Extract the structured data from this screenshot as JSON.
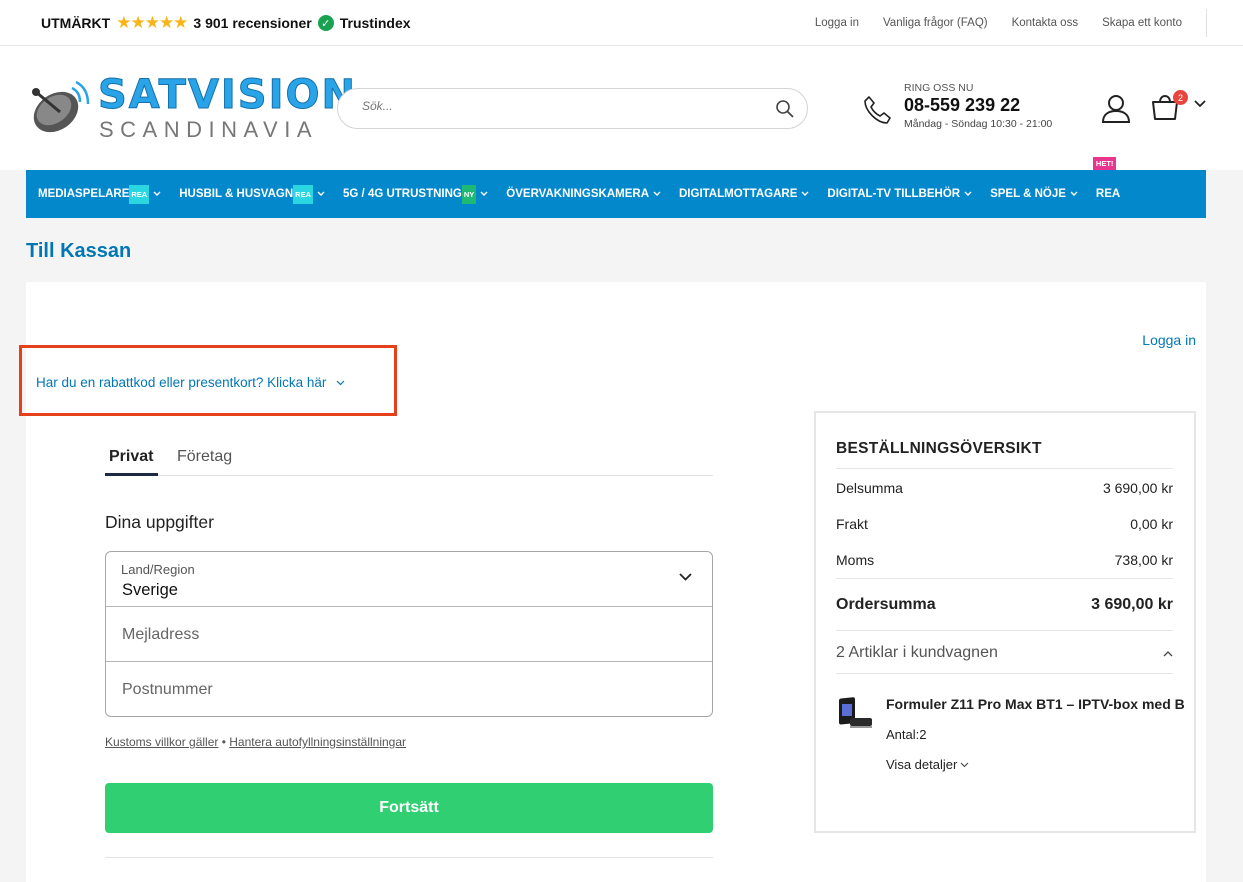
{
  "topbar": {
    "rating_label": "UTMÄRKT",
    "stars": "★★★★★",
    "reviews": "3 901 recensioner",
    "trust_brand": "Trustindex",
    "links": [
      "Logga in",
      "Vanliga frågor (FAQ)",
      "Kontakta oss",
      "Skapa ett konto"
    ]
  },
  "header": {
    "logo_title": "SATVISION",
    "logo_subtitle": "SCANDINAVIA",
    "search_placeholder": "Sök...",
    "call_label": "RING OSS NU",
    "call_number": "08-559 239 22",
    "call_hours": "Måndag - Söndag 10:30 - 21:00",
    "cart_count": "2"
  },
  "nav": {
    "items": [
      {
        "label": "MEDIASPELARE",
        "tag": "REA"
      },
      {
        "label": "HUSBIL & HUSVAGN",
        "tag": "REA"
      },
      {
        "label": "5G / 4G UTRUSTNING",
        "tag": "NY"
      },
      {
        "label": "ÖVERVAKNINGSKAMERA",
        "tag": ""
      },
      {
        "label": "DIGITALMOTTAGARE",
        "tag": ""
      },
      {
        "label": "DIGITAL-TV TILLBEHÖR",
        "tag": ""
      },
      {
        "label": "SPEL & NÖJE",
        "tag": ""
      },
      {
        "label": "REA",
        "tag": "HET!"
      }
    ]
  },
  "page": {
    "title": "Till Kassan",
    "login_link": "Logga in",
    "coupon_link": "Har du en rabattkod eller presentkort? Klicka här"
  },
  "checkout": {
    "tabs": [
      "Privat",
      "Företag"
    ],
    "section_title": "Dina uppgifter",
    "country_label": "Land/Region",
    "country_value": "Sverige",
    "email_placeholder": "Mejladress",
    "zip_placeholder": "Postnummer",
    "terms_link": "Kustoms villkor gäller",
    "terms_sep": " • ",
    "autofill_link": "Hantera autofyllningsinställningar",
    "continue_label": "Fortsätt"
  },
  "summary": {
    "title": "BESTÄLLNINGSÖVERSIKT",
    "rows": [
      {
        "label": "Delsumma",
        "value": "3 690,00 kr"
      },
      {
        "label": "Frakt",
        "value": "0,00 kr"
      },
      {
        "label": "Moms",
        "value": "738,00 kr"
      }
    ],
    "total_label": "Ordersumma",
    "total_value": "3 690,00 kr",
    "items_count": "2 Artiklar i kundvagnen",
    "product_name": "Formuler Z11 Pro Max BT1 – IPTV-box med B",
    "product_qty": "Antal:2",
    "product_details": "Visa detaljer"
  },
  "colors": {
    "brand_blue": "#0388cc",
    "link_blue": "#0277b5",
    "continue_green": "#2fcf72",
    "highlight_red": "#e5401c"
  }
}
